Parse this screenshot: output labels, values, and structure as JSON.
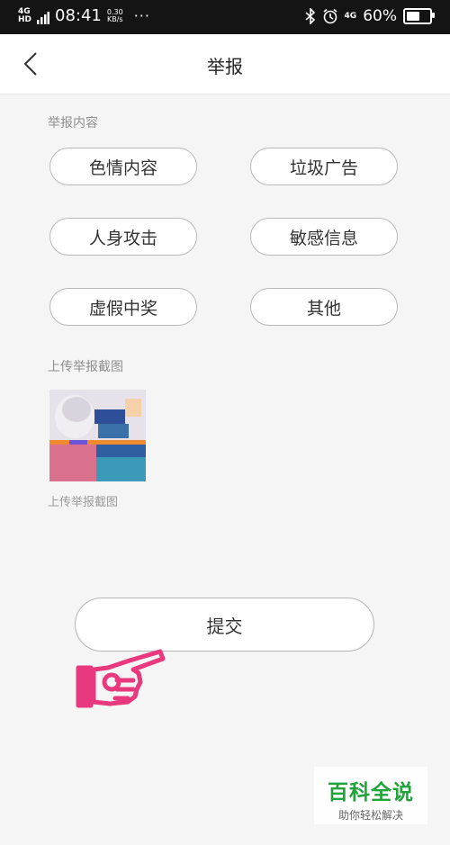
{
  "status_bar": {
    "network": "4G HD",
    "time": "08:41",
    "speed_value": "0.30",
    "speed_unit": "KB/s",
    "dots": "···",
    "right_network": "4G",
    "battery_pct": "60%",
    "battery_level": 0.6
  },
  "nav": {
    "title": "举报",
    "back_icon": "chevron-left-icon"
  },
  "report_content": {
    "label": "举报内容",
    "options": [
      "色情内容",
      "垃圾广告",
      "人身攻击",
      "敏感信息",
      "虚假中奖",
      "其他"
    ]
  },
  "upload": {
    "label": "上传举报截图",
    "caption": "上传举报截图"
  },
  "submit_label": "提交",
  "watermark": {
    "title": "百科全说",
    "subtitle": "助你轻松解决"
  },
  "colors": {
    "status_bar": "#141414",
    "watermark_green": "#1fa33a",
    "hand_pink": "#e8397f"
  }
}
